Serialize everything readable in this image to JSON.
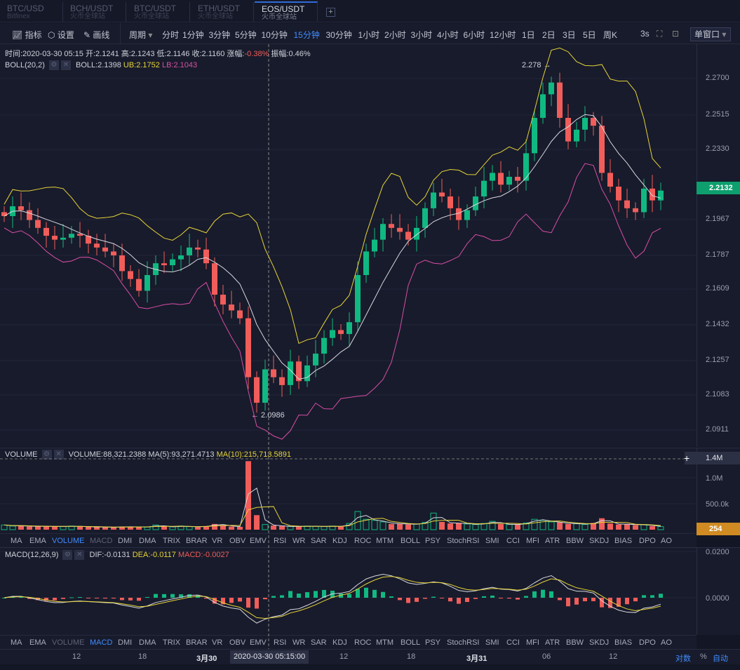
{
  "tabs": [
    {
      "pair": "BTC/USD",
      "exchange": "Bitfinex"
    },
    {
      "pair": "BCH/USDT",
      "exchange": "火币全球站"
    },
    {
      "pair": "BTC/USDT",
      "exchange": "火币全球站"
    },
    {
      "pair": "ETH/USDT",
      "exchange": "火币全球站"
    },
    {
      "pair": "EOS/USDT",
      "exchange": "火币全球站",
      "active": true
    }
  ],
  "toolbar": {
    "indicators": "指标",
    "settings": "设置",
    "draw": "画线",
    "period": "周期",
    "periods": [
      "分时",
      "1分钟",
      "3分钟",
      "5分钟",
      "10分钟",
      "15分钟",
      "30分钟",
      "1小时",
      "2小时",
      "3小时",
      "4小时",
      "6小时",
      "12小时",
      "1日",
      "2日",
      "3日",
      "5日",
      "周K"
    ],
    "active_period": "15分钟",
    "refresh": "3s",
    "window_mode": "单窗口"
  },
  "ohlc": {
    "time": "时间:2020-03-30 05:15",
    "open": "开:2.1241",
    "high": "高:2.1243",
    "low": "低:2.1146",
    "close": "收:2.1160",
    "change_label": "涨幅:",
    "change": "-0.38%",
    "amp": "振幅:0.46%"
  },
  "boll": {
    "name": "BOLL(20,2)",
    "mid": "BOLL:2.1398",
    "ub": "UB:2.1752",
    "lb": "LB:2.1043"
  },
  "price_axis": [
    "2.2700",
    "2.2515",
    "2.2330",
    "2.1967",
    "2.1787",
    "2.1609",
    "2.1432",
    "2.1257",
    "2.1083",
    "2.0911"
  ],
  "last_price": "2.2132",
  "high_mark": "2.278 →",
  "low_mark": "← 2.0986",
  "volume": {
    "name": "VOLUME",
    "vol": "VOLUME:88,321.2388",
    "ma5": "MA(5):93,271.4713",
    "ma10": "MA(10):215,713.5891",
    "axis": [
      "1.4M",
      "1.0M",
      "500.0k"
    ],
    "last": "254"
  },
  "macd": {
    "name": "MACD(12,26,9)",
    "dif": "DIF:-0.0131",
    "dea": "DEA:-0.0117",
    "macd": "MACD:-0.0027",
    "axis": [
      "0.0200",
      "0.0000"
    ]
  },
  "indicator_tabs": [
    "MA",
    "EMA",
    "VOLUME",
    "MACD",
    "DMI",
    "DMA",
    "TRIX",
    "BRAR",
    "VR",
    "OBV",
    "EMV",
    "RSI",
    "WR",
    "SAR",
    "KDJ",
    "ROC",
    "MTM",
    "BOLL",
    "PSY",
    "StochRSI",
    "SMI",
    "CCI",
    "MFI",
    "ATR",
    "BBW",
    "SKDJ",
    "BIAS",
    "DPO",
    "AO"
  ],
  "time_axis": [
    "12",
    "18",
    "3月30",
    "12",
    "18",
    "3月31",
    "06",
    "12"
  ],
  "crosshair_time": "2020-03-30 05:15:00",
  "scale_opts": [
    "对数",
    "%",
    "自动"
  ],
  "colors": {
    "up": "#10b981",
    "down": "#f05d5a",
    "boll_mid": "#d8d8e0",
    "boll_ub": "#e6d43a",
    "boll_lb": "#d84ea8",
    "accent": "#3f8cff",
    "last_price_bg": "#0e9f6e",
    "volume_last_bg": "#d08b22"
  },
  "chart_data": {
    "type": "candlestick",
    "closes": [
      2.2,
      2.205,
      2.203,
      2.198,
      2.194,
      2.19,
      2.188,
      2.189,
      2.191,
      2.19,
      2.186,
      2.184,
      2.182,
      2.18,
      2.172,
      2.168,
      2.162,
      2.17,
      2.176,
      2.175,
      2.178,
      2.18,
      2.184,
      2.183,
      2.176,
      2.16,
      2.155,
      2.152,
      2.148,
      2.118,
      2.105,
      2.122,
      2.118,
      2.114,
      2.126,
      2.116,
      2.124,
      2.13,
      2.138,
      2.142,
      2.14,
      2.146,
      2.17,
      2.182,
      2.188,
      2.196,
      2.194,
      2.192,
      2.188,
      2.194,
      2.204,
      2.212,
      2.21,
      2.204,
      2.198,
      2.203,
      2.21,
      2.218,
      2.222,
      2.216,
      2.22,
      2.218,
      2.232,
      2.25,
      2.262,
      2.268,
      2.25,
      2.238,
      2.244,
      2.25,
      2.246,
      2.222,
      2.215,
      2.208,
      2.204,
      2.202,
      2.214,
      2.208,
      2.213
    ],
    "volumes": [
      90000,
      70000,
      80000,
      60000,
      70000,
      60000,
      65000,
      60000,
      70000,
      60000,
      55000,
      50000,
      50000,
      45000,
      60000,
      50000,
      55000,
      50000,
      90000,
      60000,
      55000,
      70000,
      60000,
      50000,
      70000,
      110000,
      90000,
      60000,
      55000,
      1320000,
      280000,
      100000,
      80000,
      70000,
      60000,
      60000,
      70000,
      65000,
      60000,
      70000,
      60000,
      120000,
      350000,
      200000,
      180000,
      150000,
      110000,
      120000,
      100000,
      110000,
      140000,
      320000,
      150000,
      120000,
      130000,
      110000,
      100000,
      120000,
      160000,
      110000,
      100000,
      100000,
      130000,
      200000,
      180000,
      150000,
      140000,
      110000,
      120000,
      100000,
      130000,
      220000,
      120000,
      100000,
      110000,
      90000,
      100000,
      70000,
      60000
    ],
    "ylim": [
      2.0911,
      2.27
    ]
  }
}
